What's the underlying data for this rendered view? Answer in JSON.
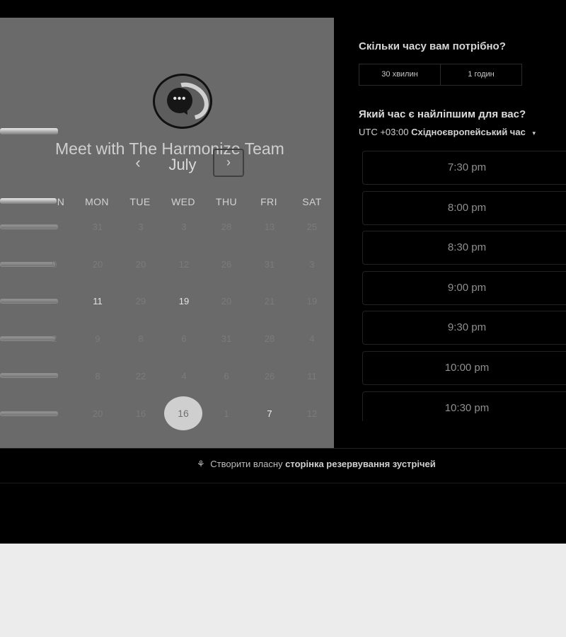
{
  "meeting": {
    "title": "Meet with The Harmonize Team",
    "avatar_dots": "•••"
  },
  "calendar": {
    "month": "July",
    "prev_icon": "‹",
    "next_icon": "›",
    "weekdays": [
      "N",
      "MON",
      "TUE",
      "WED",
      "THU",
      "FRI",
      "SAT"
    ],
    "rows": [
      [
        "",
        "31",
        "3",
        "3",
        "28",
        "13",
        "25"
      ],
      [
        "0",
        "20",
        "20",
        "12",
        "26",
        "31",
        "3"
      ],
      [
        "",
        "11",
        "29",
        "19",
        "20",
        "21",
        "19"
      ],
      [
        "2",
        "9",
        "8",
        "6",
        "31",
        "28",
        "4"
      ],
      [
        "",
        "8",
        "22",
        "4",
        "6",
        "26",
        "11"
      ],
      [
        "",
        "20",
        "16",
        "16",
        "1",
        "7",
        "12"
      ]
    ],
    "selected_day": "16"
  },
  "duration": {
    "question": "Скільки часу вам потрібно?",
    "options": [
      "30 хвилин",
      "1 годин"
    ]
  },
  "time_selection": {
    "question": "Який час є найліпшим для вас?",
    "timezone_offset": "UTC +03:00",
    "timezone_name": "Східноєвропейський час",
    "timezone_caret": "▾"
  },
  "slots": [
    "7:30 pm",
    "8:00 pm",
    "8:30 pm",
    "9:00 pm",
    "9:30 pm",
    "10:00 pm",
    "10:30 pm"
  ],
  "footer": {
    "icon": "hubspot-sprocket-icon",
    "icon_glyph": "⚘",
    "text_regular": "Створити власну",
    "text_bold": "сторінка резервування зустрічей"
  }
}
